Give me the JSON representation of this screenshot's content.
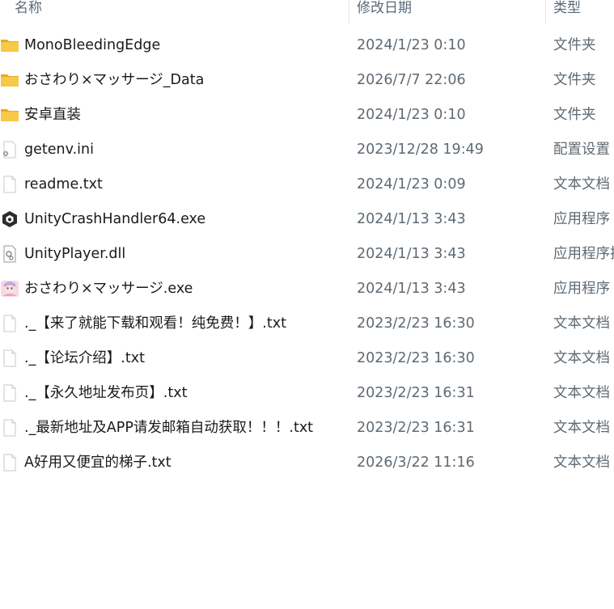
{
  "columns": {
    "name": "名称",
    "date": "修改日期",
    "type": "类型"
  },
  "files": [
    {
      "name": "MonoBleedingEdge",
      "date": "2024/1/23 0:10",
      "type": "文件夹",
      "icon": "folder-icon"
    },
    {
      "name": "おさわり×マッサージ_Data",
      "date": "2026/7/7 22:06",
      "type": "文件夹",
      "icon": "folder-icon"
    },
    {
      "name": "安卓直装",
      "date": "2024/1/23 0:10",
      "type": "文件夹",
      "icon": "folder-icon"
    },
    {
      "name": "getenv.ini",
      "date": "2023/12/28 19:49",
      "type": "配置设置",
      "icon": "config-file-icon"
    },
    {
      "name": "readme.txt",
      "date": "2024/1/23 0:09",
      "type": "文本文档",
      "icon": "text-file-icon"
    },
    {
      "name": "UnityCrashHandler64.exe",
      "date": "2024/1/13 3:43",
      "type": "应用程序",
      "icon": "unity-icon"
    },
    {
      "name": "UnityPlayer.dll",
      "date": "2024/1/13 3:43",
      "type": "应用程序扩",
      "icon": "dll-file-icon"
    },
    {
      "name": "おさわり×マッサージ.exe",
      "date": "2024/1/13 3:43",
      "type": "应用程序",
      "icon": "app-icon"
    },
    {
      "name": "._【来了就能下载和观看！纯免费！】.txt",
      "date": "2023/2/23 16:30",
      "type": "文本文档",
      "icon": "text-file-icon"
    },
    {
      "name": "._【论坛介绍】.txt",
      "date": "2023/2/23 16:30",
      "type": "文本文档",
      "icon": "text-file-icon"
    },
    {
      "name": "._【永久地址发布页】.txt",
      "date": "2023/2/23 16:31",
      "type": "文本文档",
      "icon": "text-file-icon"
    },
    {
      "name": "._最新地址及APP请发邮箱自动获取！！！.txt",
      "date": "2023/2/23 16:31",
      "type": "文本文档",
      "icon": "text-file-icon"
    },
    {
      "name": "A好用又便宜的梯子.txt",
      "date": "2026/3/22 11:16",
      "type": "文本文档",
      "icon": "text-file-icon"
    }
  ],
  "colors": {
    "folder": "#f5c342",
    "folder_dark": "#e8a91c",
    "header_text": "#5a6a78"
  }
}
